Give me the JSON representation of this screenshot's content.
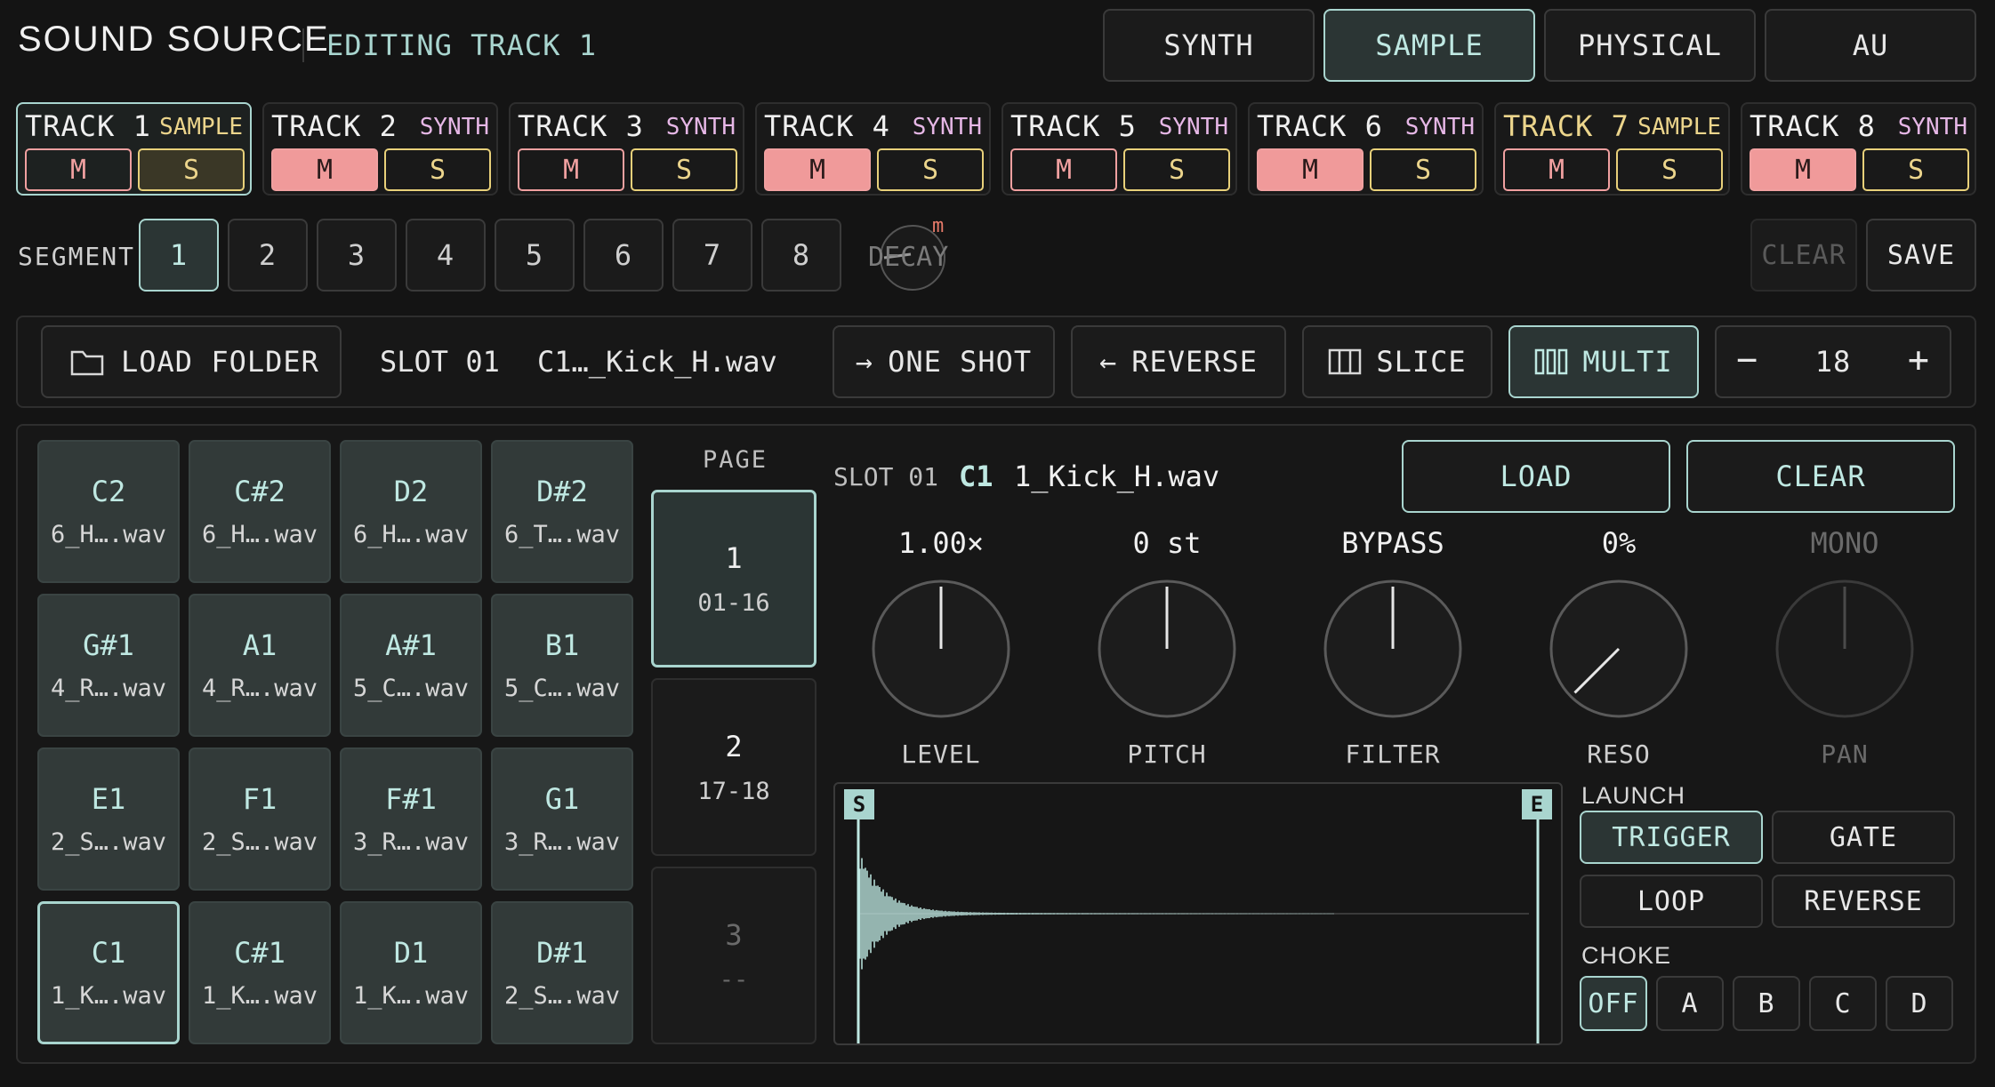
{
  "header": {
    "title": "SOUND SOURCE",
    "subtitle": "EDITING TRACK 1",
    "engine_tabs": [
      {
        "label": "SYNTH",
        "active": false
      },
      {
        "label": "SAMPLE",
        "active": true
      },
      {
        "label": "PHYSICAL",
        "active": false
      },
      {
        "label": "AU",
        "active": false
      }
    ]
  },
  "tracks": [
    {
      "name": "TRACK 1",
      "type": "SAMPLE",
      "mute_label": "M",
      "solo_label": "S",
      "muted": false,
      "selected": true
    },
    {
      "name": "TRACK 2",
      "type": "SYNTH",
      "mute_label": "M",
      "solo_label": "S",
      "muted": true,
      "selected": false
    },
    {
      "name": "TRACK 3",
      "type": "SYNTH",
      "mute_label": "M",
      "solo_label": "S",
      "muted": false,
      "selected": false
    },
    {
      "name": "TRACK 4",
      "type": "SYNTH",
      "mute_label": "M",
      "solo_label": "S",
      "muted": true,
      "selected": false
    },
    {
      "name": "TRACK 5",
      "type": "SYNTH",
      "mute_label": "M",
      "solo_label": "S",
      "muted": false,
      "selected": false
    },
    {
      "name": "TRACK 6",
      "type": "SYNTH",
      "mute_label": "M",
      "solo_label": "S",
      "muted": true,
      "selected": false
    },
    {
      "name": "TRACK 7",
      "type": "SAMPLE",
      "mute_label": "M",
      "solo_label": "S",
      "muted": false,
      "selected": false
    },
    {
      "name": "TRACK 8",
      "type": "SYNTH",
      "mute_label": "M",
      "solo_label": "S",
      "muted": true,
      "selected": false
    }
  ],
  "segments": {
    "label": "SEGMENT",
    "items": [
      "1",
      "2",
      "3",
      "4",
      "5",
      "6",
      "7",
      "8"
    ],
    "active": "1",
    "decay_knob": {
      "label": "DECAY",
      "badge": "m"
    },
    "clear_label": "CLEAR",
    "save_label": "SAVE"
  },
  "toolbar": {
    "load_folder": "LOAD FOLDER",
    "slot_label": "SLOT 01",
    "slot_file": "C1…_Kick_H.wav",
    "one_shot": "ONE SHOT",
    "reverse": "REVERSE",
    "slice": "SLICE",
    "multi": "MULTI",
    "count_minus": "−",
    "count": "18",
    "count_plus": "+"
  },
  "pads": [
    {
      "note": "C2",
      "file": "6_H….wav"
    },
    {
      "note": "C#2",
      "file": "6_H….wav"
    },
    {
      "note": "D2",
      "file": "6_H….wav"
    },
    {
      "note": "D#2",
      "file": "6_T….wav"
    },
    {
      "note": "G#1",
      "file": "4_R….wav"
    },
    {
      "note": "A1",
      "file": "4_R….wav"
    },
    {
      "note": "A#1",
      "file": "5_C….wav"
    },
    {
      "note": "B1",
      "file": "5_C….wav"
    },
    {
      "note": "E1",
      "file": "2_S….wav"
    },
    {
      "note": "F1",
      "file": "2_S….wav"
    },
    {
      "note": "F#1",
      "file": "3_R….wav"
    },
    {
      "note": "G1",
      "file": "3_R….wav"
    },
    {
      "note": "C1",
      "file": "1_K….wav",
      "active": true
    },
    {
      "note": "C#1",
      "file": "1_K….wav"
    },
    {
      "note": "D1",
      "file": "1_K….wav"
    },
    {
      "note": "D#1",
      "file": "2_S….wav"
    }
  ],
  "pages": {
    "label": "PAGE",
    "items": [
      {
        "num": "1",
        "range": "01-16",
        "active": true
      },
      {
        "num": "2",
        "range": "17-18",
        "active": false
      },
      {
        "num": "3",
        "range": "--",
        "active": false,
        "disabled": true
      }
    ]
  },
  "slot_editor": {
    "slot_label": "SLOT 01",
    "note": "C1",
    "file": "1_Kick_H.wav",
    "load_label": "LOAD",
    "clear_label": "CLEAR",
    "knobs": [
      {
        "label": "LEVEL",
        "value": "1.00×",
        "turn_deg": 0,
        "disabled": false
      },
      {
        "label": "PITCH",
        "value": "0 st",
        "turn_deg": 0,
        "disabled": false
      },
      {
        "label": "FILTER",
        "value": "BYPASS",
        "turn_deg": 0,
        "disabled": false
      },
      {
        "label": "RESO",
        "value": "0%",
        "turn_deg": -135,
        "disabled": false
      },
      {
        "label": "PAN",
        "value": "MONO",
        "turn_deg": 0,
        "disabled": true
      }
    ],
    "waveform": {
      "start_marker": "S",
      "end_marker": "E"
    },
    "launch": {
      "label": "LAUNCH",
      "modes": [
        {
          "label": "TRIGGER",
          "active": true
        },
        {
          "label": "GATE",
          "active": false
        },
        {
          "label": "LOOP",
          "active": false
        },
        {
          "label": "REVERSE",
          "active": false
        }
      ]
    },
    "choke": {
      "label": "CHOKE",
      "options": [
        {
          "label": "OFF",
          "active": true
        },
        {
          "label": "A",
          "active": false
        },
        {
          "label": "B",
          "active": false
        },
        {
          "label": "C",
          "active": false
        },
        {
          "label": "D",
          "active": false
        }
      ]
    }
  },
  "colors": {
    "accent": "#a9d5cf",
    "mute": "#f09a9a",
    "solo": "#ecd58c",
    "synth_tag": "#e6b7e6",
    "background": "#141414"
  }
}
